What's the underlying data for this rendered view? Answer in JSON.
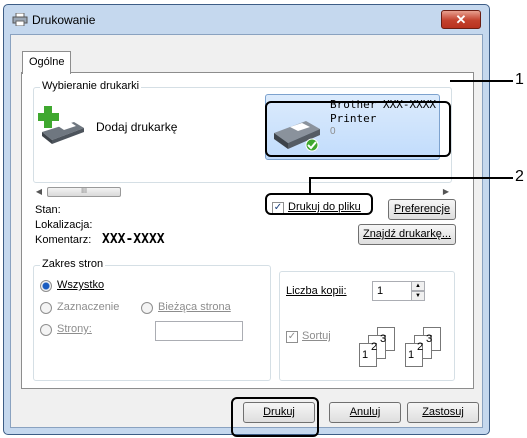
{
  "window": {
    "title": "Drukowanie",
    "close_label": "✕"
  },
  "tabs": [
    {
      "label": "Ogólne"
    }
  ],
  "select_printer": {
    "legend": "Wybieranie drukarki",
    "add_printer_label": "Dodaj drukarkę",
    "selected_printer": {
      "name": "Brother XXX-XXXX",
      "type": "Printer",
      "count": "0"
    }
  },
  "scrollbar": {
    "thumb": "III"
  },
  "status": {
    "state_label": "Stan:",
    "location_label": "Lokalizacja:",
    "comment_label": "Komentarz:",
    "comment_value": "XXX-XXXX"
  },
  "print_to_file": {
    "label": "Drukuj do pliku",
    "checked": true
  },
  "buttons": {
    "preferences": "Preferencje",
    "find_printer": "Znajdź drukarkę...",
    "print": "Drukuj",
    "cancel": "Anuluj",
    "apply": "Zastosuj"
  },
  "page_range": {
    "legend": "Zakres stron",
    "all": "Wszystko",
    "selection": "Zaznaczenie",
    "current_page": "Bieżąca strona",
    "pages": "Strony:",
    "pages_value": ""
  },
  "copies": {
    "label": "Liczba kopii:",
    "value": "1",
    "collate": "Sortuj",
    "collate_checked": true,
    "collate_icon_digits": [
      "1",
      "2",
      "3"
    ]
  },
  "callouts": {
    "one": "1",
    "two": "2"
  }
}
